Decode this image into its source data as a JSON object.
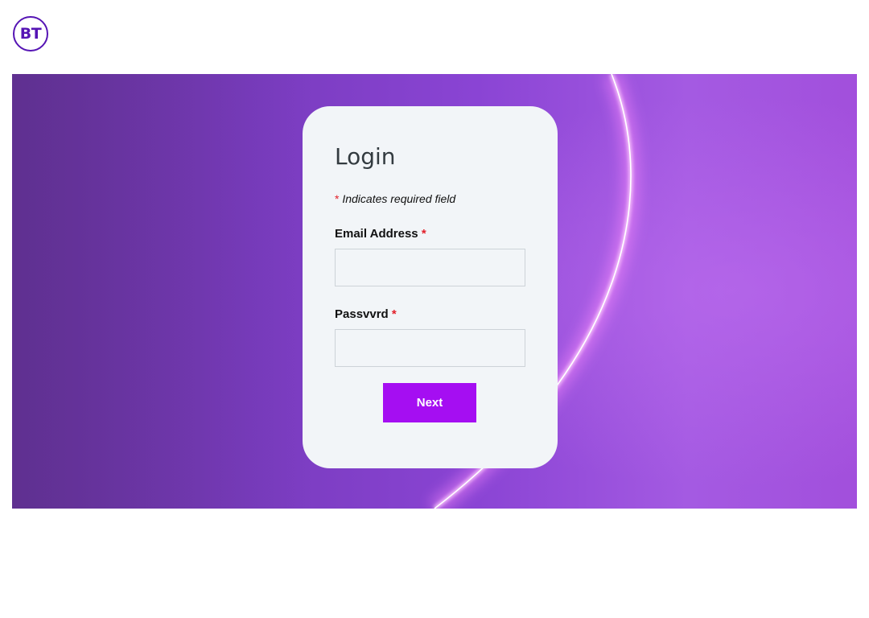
{
  "brand": {
    "logo_text": "BT",
    "color": "#5514b4"
  },
  "hero": {
    "gradient_start": "#6a3399",
    "gradient_end": "#a45ae2",
    "glow_color": "#ff88ff"
  },
  "login": {
    "title": "Login",
    "required_star": "*",
    "required_note": "Indicates required field",
    "email_label": "Email Address",
    "email_value": "",
    "email_placeholder": "",
    "password_label": "Passvvrd",
    "password_value": "",
    "password_placeholder": "",
    "next_label": "Next",
    "button_color": "#a50ef2"
  }
}
